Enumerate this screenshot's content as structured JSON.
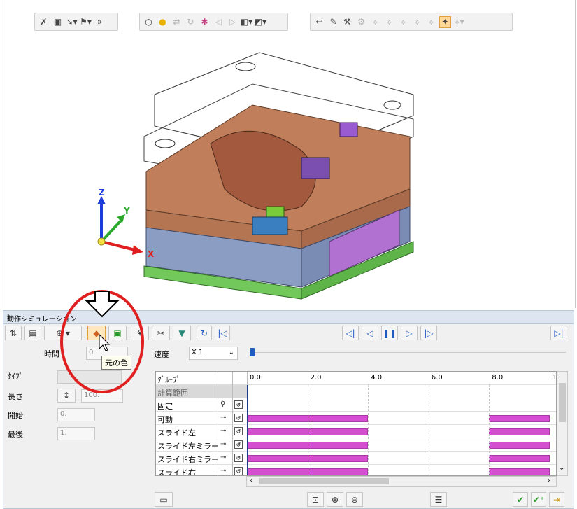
{
  "viewport": {
    "axes": {
      "z": "Z",
      "y": "Y",
      "x": "X"
    },
    "toolbar1": [
      "select-icon",
      "box-select-icon",
      "pointer-dropdown-icon",
      "filter-dropdown-icon",
      "more-icon"
    ],
    "toolbar2": [
      "bulb-outline-icon",
      "bulb-on-icon",
      "move-icon",
      "rotate-icon",
      "color-icon",
      "arrow-left-icon",
      "arrow-right-icon",
      "cube-dropdown-icon",
      "cube2-dropdown-icon"
    ],
    "toolbar3": [
      "undo-icon",
      "pin-icon",
      "tool-icon",
      "copy-a-icon",
      "copy-b-icon",
      "copy-c-icon",
      "copy-d-icon",
      "copy-e-icon",
      "mirror-icon",
      "highlight-tool-icon",
      "tool-last-icon"
    ]
  },
  "panel": {
    "title": "動作シミュレーション",
    "pin": "ᵻ",
    "tooltip": "元の色",
    "time_label": "時間",
    "time_value": "0.",
    "speed_label": "速度",
    "speed_value": "X 1",
    "type_label": "ﾀｲﾌﾟ",
    "length_label": "長さ",
    "length_value": "100.",
    "start_label": "開始",
    "start_value": "0.",
    "end_label": "最後",
    "end_value": "1."
  },
  "timeline": {
    "group_header": "ｸﾞﾙｰﾌﾟ",
    "ticks": [
      "0.0",
      "2.0",
      "4.0",
      "6.0",
      "8.0",
      "1"
    ],
    "rows": [
      {
        "name": "計算範囲",
        "section": true
      },
      {
        "name": "固定",
        "bars": []
      },
      {
        "name": "可動",
        "bars": [
          [
            0,
            4
          ],
          [
            8,
            10
          ]
        ]
      },
      {
        "name": "スライド左",
        "bars": [
          [
            0,
            4
          ],
          [
            8,
            10
          ]
        ]
      },
      {
        "name": "スライド左ミラー",
        "bars": [
          [
            0,
            4
          ],
          [
            8,
            10
          ]
        ]
      },
      {
        "name": "スライド右ミラー",
        "bars": [
          [
            0,
            4
          ],
          [
            8,
            10
          ]
        ]
      },
      {
        "name": "スライド右",
        "bars": [
          [
            0,
            4
          ],
          [
            8,
            10
          ]
        ]
      }
    ]
  },
  "colors": {
    "bar": "#d34fd0",
    "annotation": "#e02020",
    "play": "#1f5bbf"
  }
}
